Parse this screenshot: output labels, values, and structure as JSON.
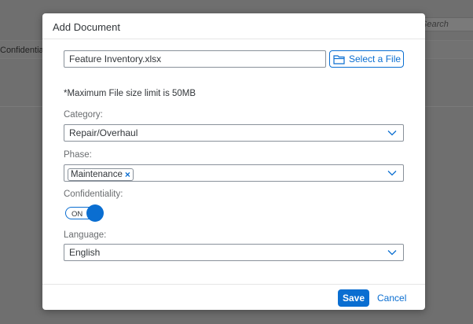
{
  "background": {
    "search_placeholder": "Search",
    "column_text": "Confidentiality"
  },
  "dialog": {
    "title": "Add Document",
    "file": {
      "value": "Feature Inventory.xlsx",
      "button_label": "Select a File",
      "button_icon": "folder-icon",
      "hint": "*Maximum File size limit is 50MB"
    },
    "category": {
      "label": "Category:",
      "value": "Repair/Overhaul"
    },
    "phase": {
      "label": "Phase:",
      "tokens": [
        "Maintenance"
      ]
    },
    "confidentiality": {
      "label": "Confidentiality:",
      "state": "ON"
    },
    "language": {
      "label": "Language:",
      "value": "English"
    },
    "footer": {
      "save_label": "Save",
      "cancel_label": "Cancel"
    }
  },
  "colors": {
    "accent": "#0a6ed1",
    "overlay": "#6f6f6f"
  }
}
